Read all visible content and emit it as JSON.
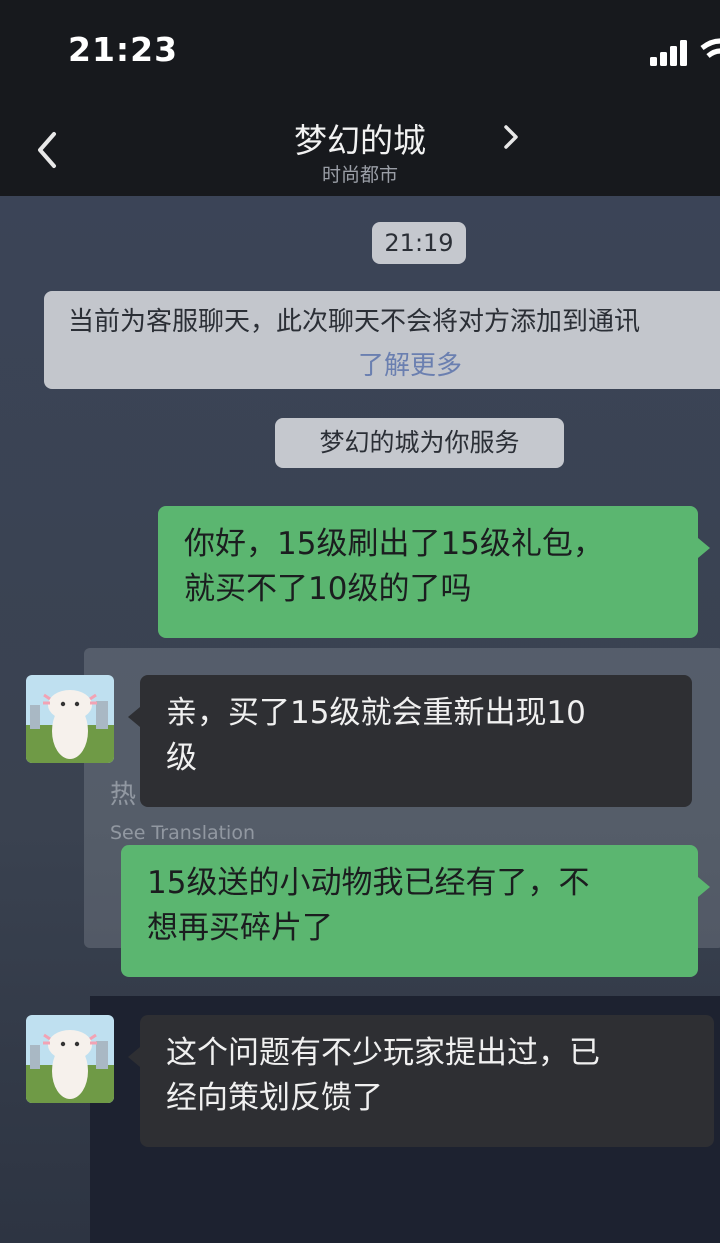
{
  "status_bar": {
    "time": "21:23"
  },
  "nav": {
    "title": "梦幻的城",
    "subtitle": "时尚都市"
  },
  "chat": {
    "timestamp": "21:19",
    "notice_text": "当前为客服聊天，此次聊天不会将对方添加到通讯",
    "notice_link": "了解更多",
    "service_notice": "梦幻的城为你服务",
    "messages": [
      {
        "sender": "me",
        "line1": "你好，15级刷出了15级礼包，",
        "line2": "就买不了10级的了吗"
      },
      {
        "sender": "them",
        "line1": "亲，买了15级就会重新出现10",
        "line2": "级"
      },
      {
        "sender": "me",
        "line1": "15级送的小动物我已经有了，不",
        "line2": "想再买碎片了"
      },
      {
        "sender": "them",
        "line1": "这个问题有不少玩家提出过，已",
        "line2": "经向策划反馈了"
      }
    ],
    "background_text": "热",
    "background_translate": "See Translation"
  },
  "colors": {
    "my_bubble": "#5bb670",
    "their_bubble": "#2e2f33",
    "bar": "#17191d"
  }
}
